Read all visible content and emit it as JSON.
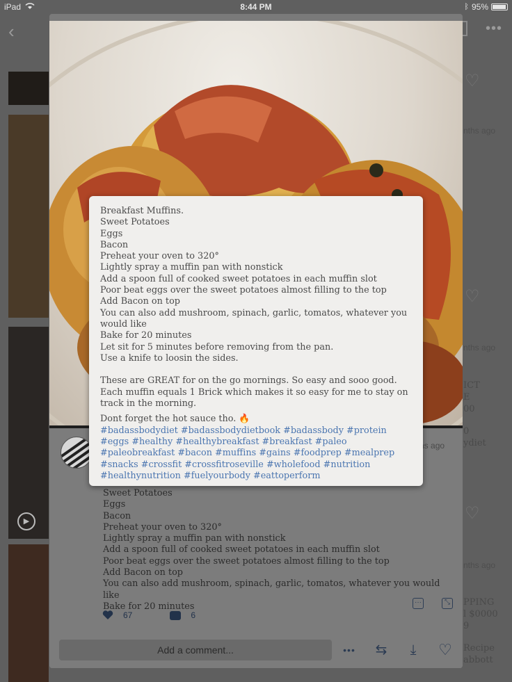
{
  "status_bar": {
    "device": "iPad",
    "time": "8:44 PM",
    "battery": "95%"
  },
  "background": {
    "time_ago_1": "nths ago",
    "time_ago_2": "nths ago",
    "time_ago_3": "nths ago",
    "side_text_1": "ICT",
    "side_text_2": "E",
    "side_text_3": "00",
    "side_text_4": "0",
    "side_text_5": "ydiet",
    "side_text_6": "PPING",
    "side_text_7": "l $0000",
    "side_text_8": "9",
    "side_text_9": "Recipe",
    "side_text_10": "abbott"
  },
  "pin": {
    "time_ago": "nths ago",
    "description": "Sweet Potatoes\nEggs\nBacon\nPreheat your oven to 320°\nLightly spray a muffin pan with nonstick\nAdd a spoon full of cooked sweet potatoes in each muffin slot\nPoor beat eggs over the sweet potatoes almost filling to the top\nAdd Bacon on top\nYou can also add mushroom, spinach, garlic, tomatos, whatever you would like\nBake for 20 minutes",
    "likes": "67",
    "comments": "6",
    "comment_placeholder": "Add a comment..."
  },
  "popup": {
    "body": "Breakfast Muffins.\nSweet Potatoes\nEggs\nBacon\nPreheat your oven to 320°\nLightly spray a muffin pan with nonstick\nAdd a spoon full of cooked sweet potatoes in each muffin slot\nPoor beat eggs over the sweet potatoes almost filling to the top\nAdd Bacon on top\nYou can also add mushroom, spinach, garlic, tomatos, whatever you would like\nBake for 20 minutes\nLet sit for 5 minutes before removing from the pan.\nUse a knife to loosin the sides.\n\nThese are GREAT for on the go mornings. So easy and sooo good. Each muffin equals 1 Brick which makes it so easy for me to stay on track in the morning.",
    "closing": "Dont forget the hot sauce tho. 🔥",
    "hashtags": "#badassbodydiet #badassbodydietbook #badassbody #protein #eggs #healthy #healthybreakfast #breakfast #paleo #paleobreakfast #bacon #muffins #gains #foodprep #mealprep #snacks #crossfit #crossfitroseville #wholefood #nutrition #healthynutrition #fuelyourbody #eattoperform"
  },
  "icons": {
    "back": "chevron-left-icon",
    "more": "ellipsis-icon",
    "share": "share-icon",
    "like": "heart-icon",
    "comment": "comment-bubble-icon",
    "repin": "repin-icon",
    "download": "download-icon",
    "play": "play-icon"
  },
  "colors": {
    "hashtag": "#4a75b0",
    "accent_dark": "#22324a"
  }
}
